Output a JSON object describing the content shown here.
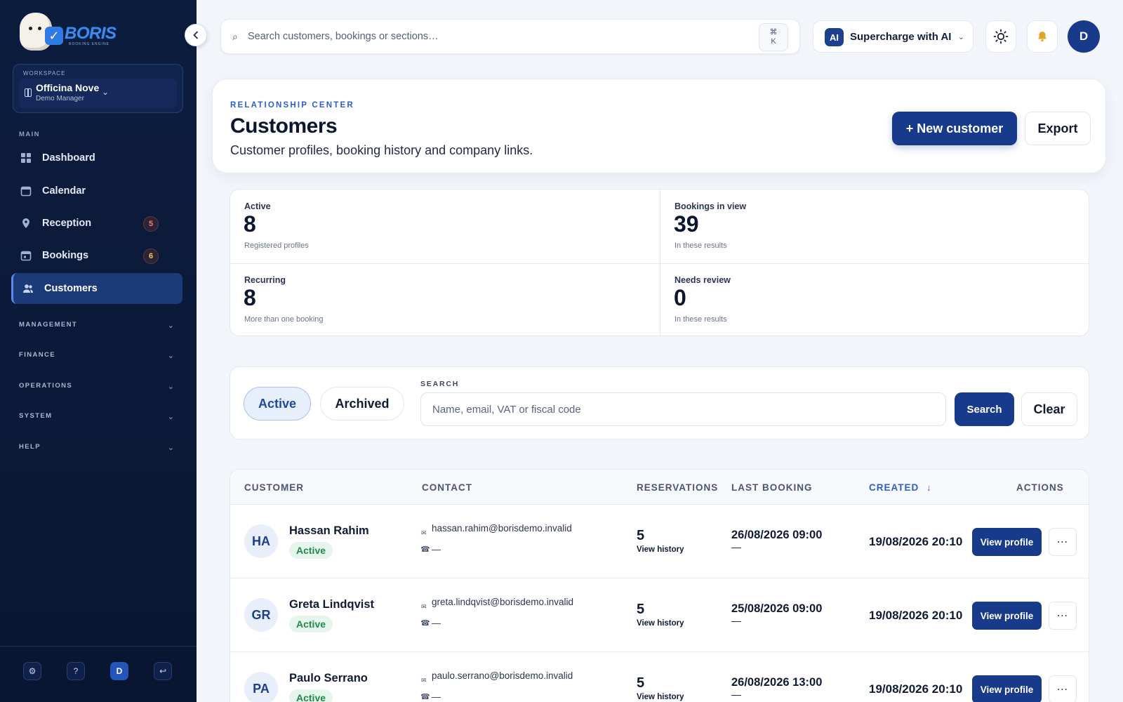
{
  "brand": {
    "name": "BORIS",
    "tagline": "BOOKING ENGINE"
  },
  "workspace": {
    "label": "WORKSPACE",
    "name": "Officina Nove",
    "role": "Demo Manager"
  },
  "sidebar": {
    "main_label": "MAIN",
    "items": [
      {
        "label": "Dashboard",
        "icon": "grid-icon"
      },
      {
        "label": "Calendar",
        "icon": "calendar-icon"
      },
      {
        "label": "Reception",
        "icon": "location-pin-icon",
        "badge": "5",
        "badge_color": "#ff7a7a"
      },
      {
        "label": "Bookings",
        "icon": "calendar-check-icon",
        "badge": "6",
        "badge_color": "#f4c66b"
      },
      {
        "label": "Customers",
        "icon": "people-icon",
        "active": true
      }
    ],
    "groups": [
      {
        "label": "MANAGEMENT"
      },
      {
        "label": "FINANCE"
      },
      {
        "label": "OPERATIONS"
      },
      {
        "label": "SYSTEM"
      },
      {
        "label": "HELP"
      }
    ],
    "footer": {
      "avatar_initial": "D"
    }
  },
  "topbar": {
    "search_placeholder": "Search customers, bookings or sections…",
    "shortcut_symbol": "⌘",
    "shortcut_key": "K",
    "ai_badge": "AI",
    "ai_label": "Supercharge with AI",
    "user_initial": "D"
  },
  "header": {
    "eyebrow": "RELATIONSHIP CENTER",
    "title": "Customers",
    "subtitle": "Customer profiles, booking history and company links.",
    "new_button": "+ New customer",
    "export_button": "Export"
  },
  "stats": [
    {
      "label": "Active",
      "value": "8",
      "note": "Registered profiles"
    },
    {
      "label": "Bookings in view",
      "value": "39",
      "note": "In these results"
    },
    {
      "label": "Recurring",
      "value": "8",
      "note": "More than one booking"
    },
    {
      "label": "Needs review",
      "value": "0",
      "note": "In these results"
    }
  ],
  "filters": {
    "tab_active": "Active",
    "tab_archived": "Archived",
    "search_label": "SEARCH",
    "search_placeholder": "Name, email, VAT or fiscal code",
    "search_button": "Search",
    "clear_button": "Clear"
  },
  "table": {
    "columns": [
      "CUSTOMER",
      "CONTACT",
      "RESERVATIONS",
      "LAST BOOKING",
      "CREATED",
      "ACTIONS"
    ],
    "sorted_column": "CREATED",
    "sort_glyph": "↓",
    "rows": [
      {
        "initials": "HA",
        "name": "Hassan Rahim",
        "status": "Active",
        "email": "hassan.rahim@borisdemo.invalid",
        "phone": "—",
        "reservations": "5",
        "history_link": "View history",
        "last_booking": "26/08/2026 09:00",
        "last_booking_sub": "—",
        "created": "19/08/2026 20:10",
        "view_button": "View profile",
        "more": "⋯"
      },
      {
        "initials": "GR",
        "name": "Greta Lindqvist",
        "status": "Active",
        "email": "greta.lindqvist@borisdemo.invalid",
        "phone": "—",
        "reservations": "5",
        "history_link": "View history",
        "last_booking": "25/08/2026 09:00",
        "last_booking_sub": "—",
        "created": "19/08/2026 20:10",
        "view_button": "View profile",
        "more": "⋯"
      },
      {
        "initials": "PA",
        "name": "Paulo Serrano",
        "status": "Active",
        "email": "paulo.serrano@borisdemo.invalid",
        "phone": "—",
        "reservations": "5",
        "history_link": "View history",
        "last_booking": "26/08/2026 13:00",
        "last_booking_sub": "—",
        "created": "19/08/2026 20:10",
        "view_button": "View profile",
        "more": "⋯"
      }
    ]
  },
  "colors": {
    "primary": "#173b8a",
    "accent": "#2a5fc9",
    "sidebar_bg": "#0c1c3d",
    "success": "#1f8a4c"
  }
}
